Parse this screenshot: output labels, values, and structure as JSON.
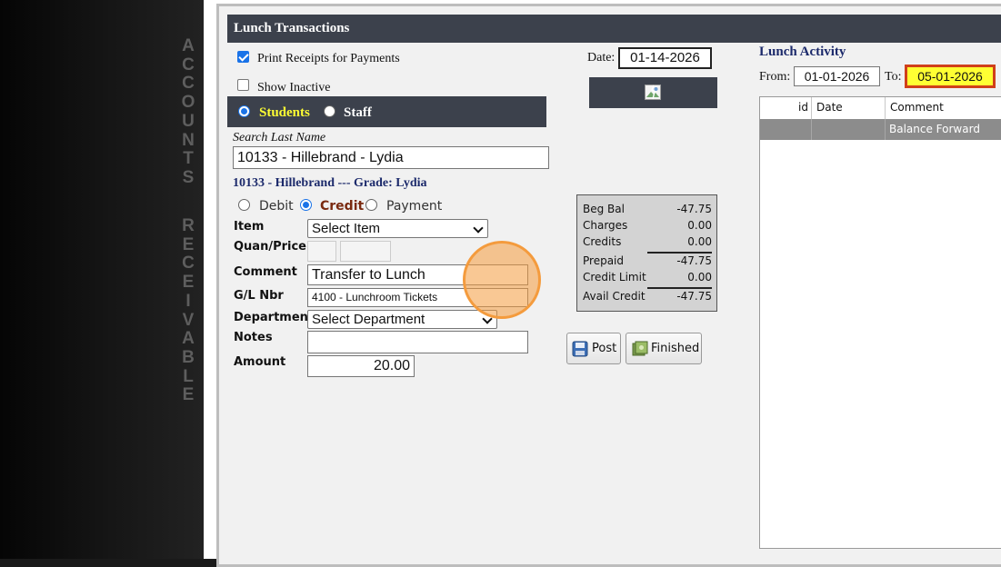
{
  "sidebar": {
    "vertical_word_1": "ACCOUNTS",
    "vertical_word_2": "RECEIVABLE"
  },
  "header": {
    "title": "Lunch Transactions"
  },
  "options": {
    "print_receipts_label": "Print Receipts for Payments",
    "print_receipts_checked": true,
    "show_inactive_label": "Show Inactive",
    "show_inactive_checked": false
  },
  "date": {
    "label": "Date:",
    "value": "01-14-2026"
  },
  "person_type": {
    "students_label": "Students",
    "staff_label": "Staff",
    "selected": "Students"
  },
  "search": {
    "label": "Search Last Name",
    "value": "10133 - Hillebrand - Lydia"
  },
  "selected_student": "10133 - Hillebrand --- Grade: Lydia",
  "transaction_type": {
    "debit_label": "Debit",
    "credit_label": "Credit",
    "payment_label": "Payment",
    "selected": "Credit"
  },
  "form": {
    "item_label": "Item",
    "item_value": "Select Item",
    "quan_price_label": "Quan/Price",
    "comment_label": "Comment",
    "comment_value": "Transfer to Lunch",
    "gl_label": "G/L Nbr",
    "gl_value": "4100 - Lunchroom Tickets",
    "department_label": "Department",
    "department_value": "Select Department",
    "notes_label": "Notes",
    "notes_value": "",
    "amount_label": "Amount",
    "amount_value": "20.00"
  },
  "balance": {
    "rows": [
      {
        "label": "Beg Bal",
        "value": "-47.75"
      },
      {
        "label": "Charges",
        "value": "0.00"
      },
      {
        "label": "Credits",
        "value": "0.00"
      },
      {
        "label": "Prepaid",
        "value": "-47.75"
      },
      {
        "label": "Credit Limit",
        "value": "0.00"
      },
      {
        "label": "Avail Credit",
        "value": "-47.75"
      }
    ]
  },
  "buttons": {
    "post_label": "Post",
    "finished_label": "Finished"
  },
  "activity": {
    "title": "Lunch Activity",
    "from_label": "From:",
    "from_value": "01-01-2026",
    "to_label": "To:",
    "to_value": "05-01-2026",
    "columns": [
      "id",
      "Date",
      "Comment"
    ],
    "rows": [
      {
        "id": "",
        "date": "",
        "comment": "Balance Forward"
      }
    ]
  },
  "colors": {
    "header_bg": "#3c414c",
    "accent_blue": "#1a73e8",
    "students_yellow": "#ffff33",
    "credit_label": "#7a2a10",
    "to_date_bg": "#ffff33",
    "to_date_border": "#d0401a",
    "highlight_row": "#8c8c8c",
    "click_marker": "#f49b3d"
  },
  "icons": {
    "post": "floppy-disk-icon",
    "finished": "cash-stack-icon",
    "broken_image": "broken-image-icon"
  }
}
